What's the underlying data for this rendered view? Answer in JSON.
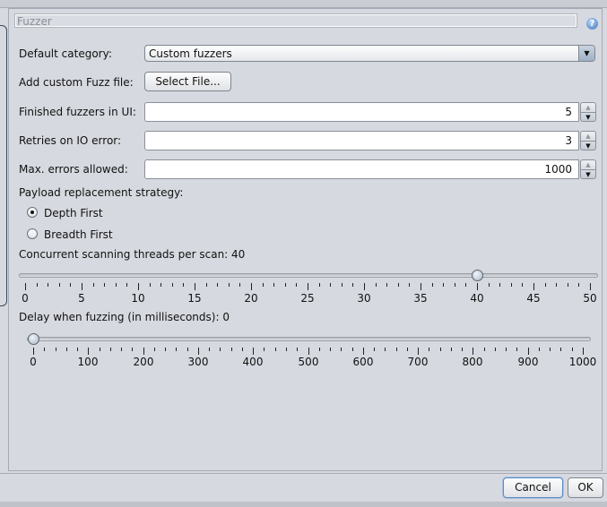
{
  "section_title": "Fuzzer",
  "help_icon": "help-icon",
  "default_category": {
    "label": "Default category:",
    "value": "Custom fuzzers"
  },
  "custom_file": {
    "label": "Add custom Fuzz file:",
    "button": "Select File..."
  },
  "finished_fuzzers": {
    "label": "Finished fuzzers in UI:",
    "value": "5"
  },
  "retries": {
    "label": "Retries on IO error:",
    "value": "3"
  },
  "max_errors": {
    "label": "Max. errors allowed:",
    "value": "1000"
  },
  "payload_strategy": {
    "label": "Payload replacement strategy:",
    "options": [
      {
        "label": "Depth First",
        "selected": true
      },
      {
        "label": "Breadth First",
        "selected": false
      }
    ]
  },
  "threads": {
    "label": "Concurrent scanning threads per scan:",
    "value": "40",
    "min": 0,
    "max": 50,
    "major": 5,
    "minor": 1,
    "tick_labels": [
      "0",
      "5",
      "10",
      "15",
      "20",
      "25",
      "30",
      "35",
      "40",
      "45",
      "50"
    ]
  },
  "delay": {
    "label": "Delay when fuzzing (in milliseconds):",
    "value": "0",
    "min": 0,
    "max": 1000,
    "major": 100,
    "minor": 20,
    "tick_labels": [
      "0",
      "100",
      "200",
      "300",
      "400",
      "500",
      "600",
      "700",
      "800",
      "900",
      "1000"
    ]
  },
  "buttons": {
    "cancel": "Cancel",
    "ok": "OK"
  }
}
